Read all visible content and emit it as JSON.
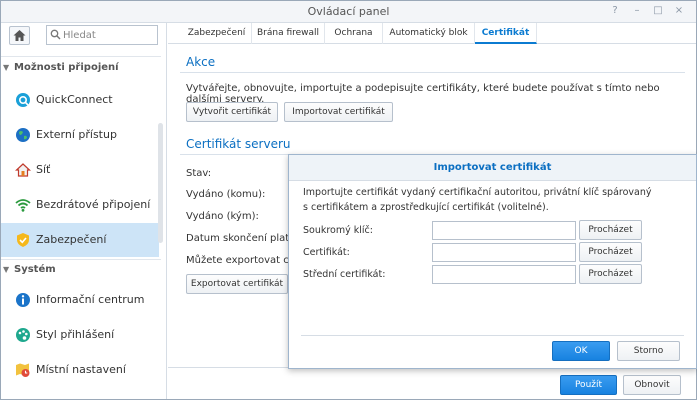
{
  "window": {
    "title": "Ovládací panel"
  },
  "sidebar": {
    "search_placeholder": "Hledat",
    "sections": [
      {
        "label": "Možnosti připojení"
      },
      {
        "label": "Systém"
      }
    ],
    "items": [
      {
        "label": "QuickConnect",
        "icon": "quickconnect-icon"
      },
      {
        "label": "Externí přístup",
        "icon": "globe-icon"
      },
      {
        "label": "Síť",
        "icon": "network-house-icon"
      },
      {
        "label": "Bezdrátové připojení",
        "icon": "wifi-icon"
      },
      {
        "label": "Zabezpečení",
        "icon": "shield-icon",
        "active": true
      },
      {
        "label": "Informační centrum",
        "icon": "info-icon"
      },
      {
        "label": "Styl přihlášení",
        "icon": "palette-icon"
      },
      {
        "label": "Místní nastavení",
        "icon": "map-clock-icon"
      }
    ]
  },
  "tabs": [
    {
      "label": "Zabezpečení"
    },
    {
      "label": "Brána firewall"
    },
    {
      "label": "Ochrana"
    },
    {
      "label": "Automatický blok"
    },
    {
      "label": "Certifikát",
      "active": true
    }
  ],
  "akce": {
    "title": "Akce",
    "description": "Vytvářejte, obnovujte, importujte a podepisujte certifikáty, které budete používat s tímto nebo dalšími servery.",
    "create_button": "Vytvořit certifikát",
    "import_button": "Importovat certifikát"
  },
  "server_cert": {
    "title": "Certifikát serveru",
    "fields": [
      "Stav:",
      "Vydáno (komu):",
      "Vydáno (kým):",
      "Datum skončení platnost",
      "Můžete exportovat certif"
    ],
    "export_button": "Exportovat certifikát"
  },
  "footer": {
    "apply_button": "Použít",
    "refresh_button": "Obnovit"
  },
  "modal": {
    "title": "Importovat certifikát",
    "description_line1": "Importujte certifikát vydaný certifikační autoritou, privátní klíč spárovaný",
    "description_line2": "s certifikátem a zprostředkující certifikát (volitelné).",
    "rows": [
      {
        "label": "Soukromý klíč:",
        "value": "",
        "browse": "Procházet"
      },
      {
        "label": "Certifikát:",
        "value": "",
        "browse": "Procházet"
      },
      {
        "label": "Střední certifikát:",
        "value": "",
        "browse": "Procházet"
      }
    ],
    "ok_button": "OK",
    "cancel_button": "Storno"
  },
  "colors": {
    "accent": "#0b7bd1",
    "active_item_bg": "#cde4f7",
    "primary_button": "#1782e0"
  }
}
